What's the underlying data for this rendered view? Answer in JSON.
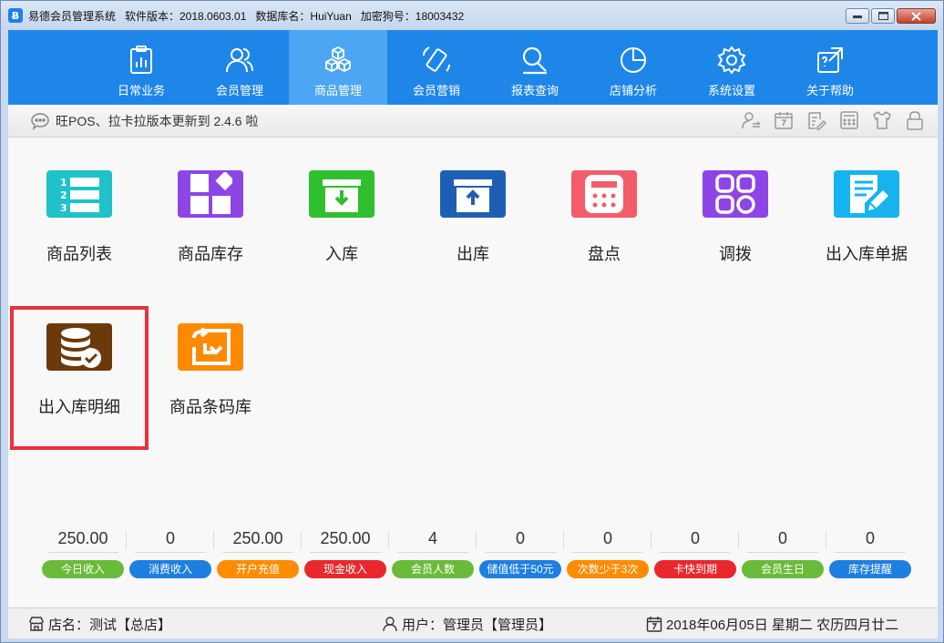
{
  "window": {
    "title": "易德会员管理系统   软件版本：2018.0603.01   数据库名：HuiYuan   加密狗号：18003432",
    "app_icon_glyph": "Ƀ"
  },
  "nav": {
    "items": [
      {
        "label": "日常业务",
        "icon": "clipboard-chart-icon"
      },
      {
        "label": "会员管理",
        "icon": "members-icon"
      },
      {
        "label": "商品管理",
        "icon": "boxes-icon",
        "active": true
      },
      {
        "label": "会员营销",
        "icon": "phone-icon"
      },
      {
        "label": "报表查询",
        "icon": "magnifier-icon"
      },
      {
        "label": "店铺分析",
        "icon": "pie-chart-icon"
      },
      {
        "label": "系统设置",
        "icon": "gear-icon"
      },
      {
        "label": "关于帮助",
        "icon": "help-icon"
      }
    ]
  },
  "notice": {
    "text": "旺POS、拉卡拉版本更新到 2.4.6 啦",
    "tools": [
      "user-switch-icon",
      "calendar-icon",
      "edit-list-icon",
      "calculator-icon",
      "shirt-icon",
      "lock-icon"
    ]
  },
  "modules": [
    {
      "label": "商品列表",
      "color": "#1fc2c9",
      "icon": "numbered-list-icon"
    },
    {
      "label": "商品库存",
      "color": "#8e45e6",
      "icon": "tiles-icon"
    },
    {
      "label": "入库",
      "color": "#2fbf2f",
      "icon": "inbox-in-icon"
    },
    {
      "label": "出库",
      "color": "#1f5fb3",
      "icon": "inbox-out-icon"
    },
    {
      "label": "盘点",
      "color": "#f45c6b",
      "icon": "calculator-icon"
    },
    {
      "label": "调拨",
      "color": "#8e45e6",
      "icon": "apps-icon"
    },
    {
      "label": "出入库单据",
      "color": "#17b3f0",
      "icon": "document-edit-icon"
    },
    {
      "label": "出入库明细",
      "color": "#6b3a0a",
      "icon": "database-check-icon"
    },
    {
      "label": "商品条码库",
      "color": "#ff8a00",
      "icon": "barcode-box-icon"
    }
  ],
  "stats": [
    {
      "value": "250.00",
      "label": "今日收入",
      "color": "#6abb3a"
    },
    {
      "value": "0",
      "label": "消费收入",
      "color": "#1f7fe0"
    },
    {
      "value": "250.00",
      "label": "开户充值",
      "color": "#ff8c00"
    },
    {
      "value": "250.00",
      "label": "现金收入",
      "color": "#e8282d"
    },
    {
      "value": "4",
      "label": "会员人数",
      "color": "#6abb3a"
    },
    {
      "value": "0",
      "label": "储值低于50元",
      "color": "#1f7fe0"
    },
    {
      "value": "0",
      "label": "次数少于3次",
      "color": "#ff8c00"
    },
    {
      "value": "0",
      "label": "卡快到期",
      "color": "#e8282d"
    },
    {
      "value": "0",
      "label": "会员生日",
      "color": "#6abb3a"
    },
    {
      "value": "0",
      "label": "库存提醒",
      "color": "#1f7fe0"
    }
  ],
  "status": {
    "store": "店名：测试【总店】",
    "user": "用户：管理员【管理员】",
    "date": "2018年06月05日 星期二 农历四月廿二"
  }
}
